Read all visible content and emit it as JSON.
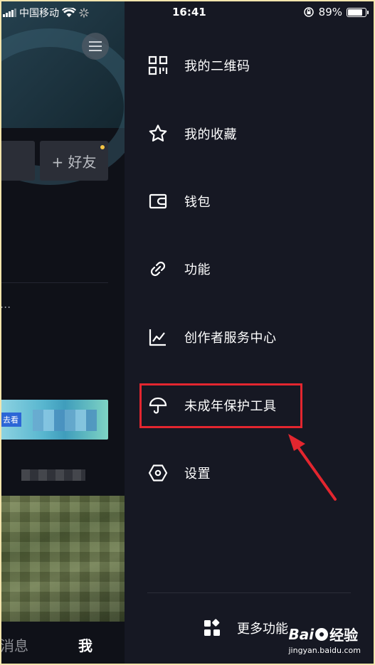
{
  "status_bar": {
    "carrier": "中国移动",
    "time": "16:41",
    "battery_percent": "89%",
    "battery_level": 0.89
  },
  "background_page": {
    "add_friend_label": "+ 好友",
    "dots": "...",
    "banner_tag": "去看",
    "tab_messages": "消息",
    "tab_me": "我"
  },
  "drawer": {
    "items": [
      {
        "label": "我的二维码",
        "icon": "qr-code-icon"
      },
      {
        "label": "我的收藏",
        "icon": "star-icon"
      },
      {
        "label": "钱包",
        "icon": "wallet-icon"
      },
      {
        "label": "功能",
        "icon": "link-icon"
      },
      {
        "label": "创作者服务中心",
        "icon": "chart-icon"
      },
      {
        "label": "未成年保护工具",
        "icon": "umbrella-icon"
      },
      {
        "label": "设置",
        "icon": "hexagon-settings-icon"
      }
    ],
    "more_label": "更多功能",
    "more_icon": "grid-icon"
  },
  "annotation": {
    "highlight_color": "#e3262f"
  },
  "watermark": {
    "brand": "Bai",
    "brand_suffix": "经验",
    "url": "jingyan.baidu.com"
  }
}
